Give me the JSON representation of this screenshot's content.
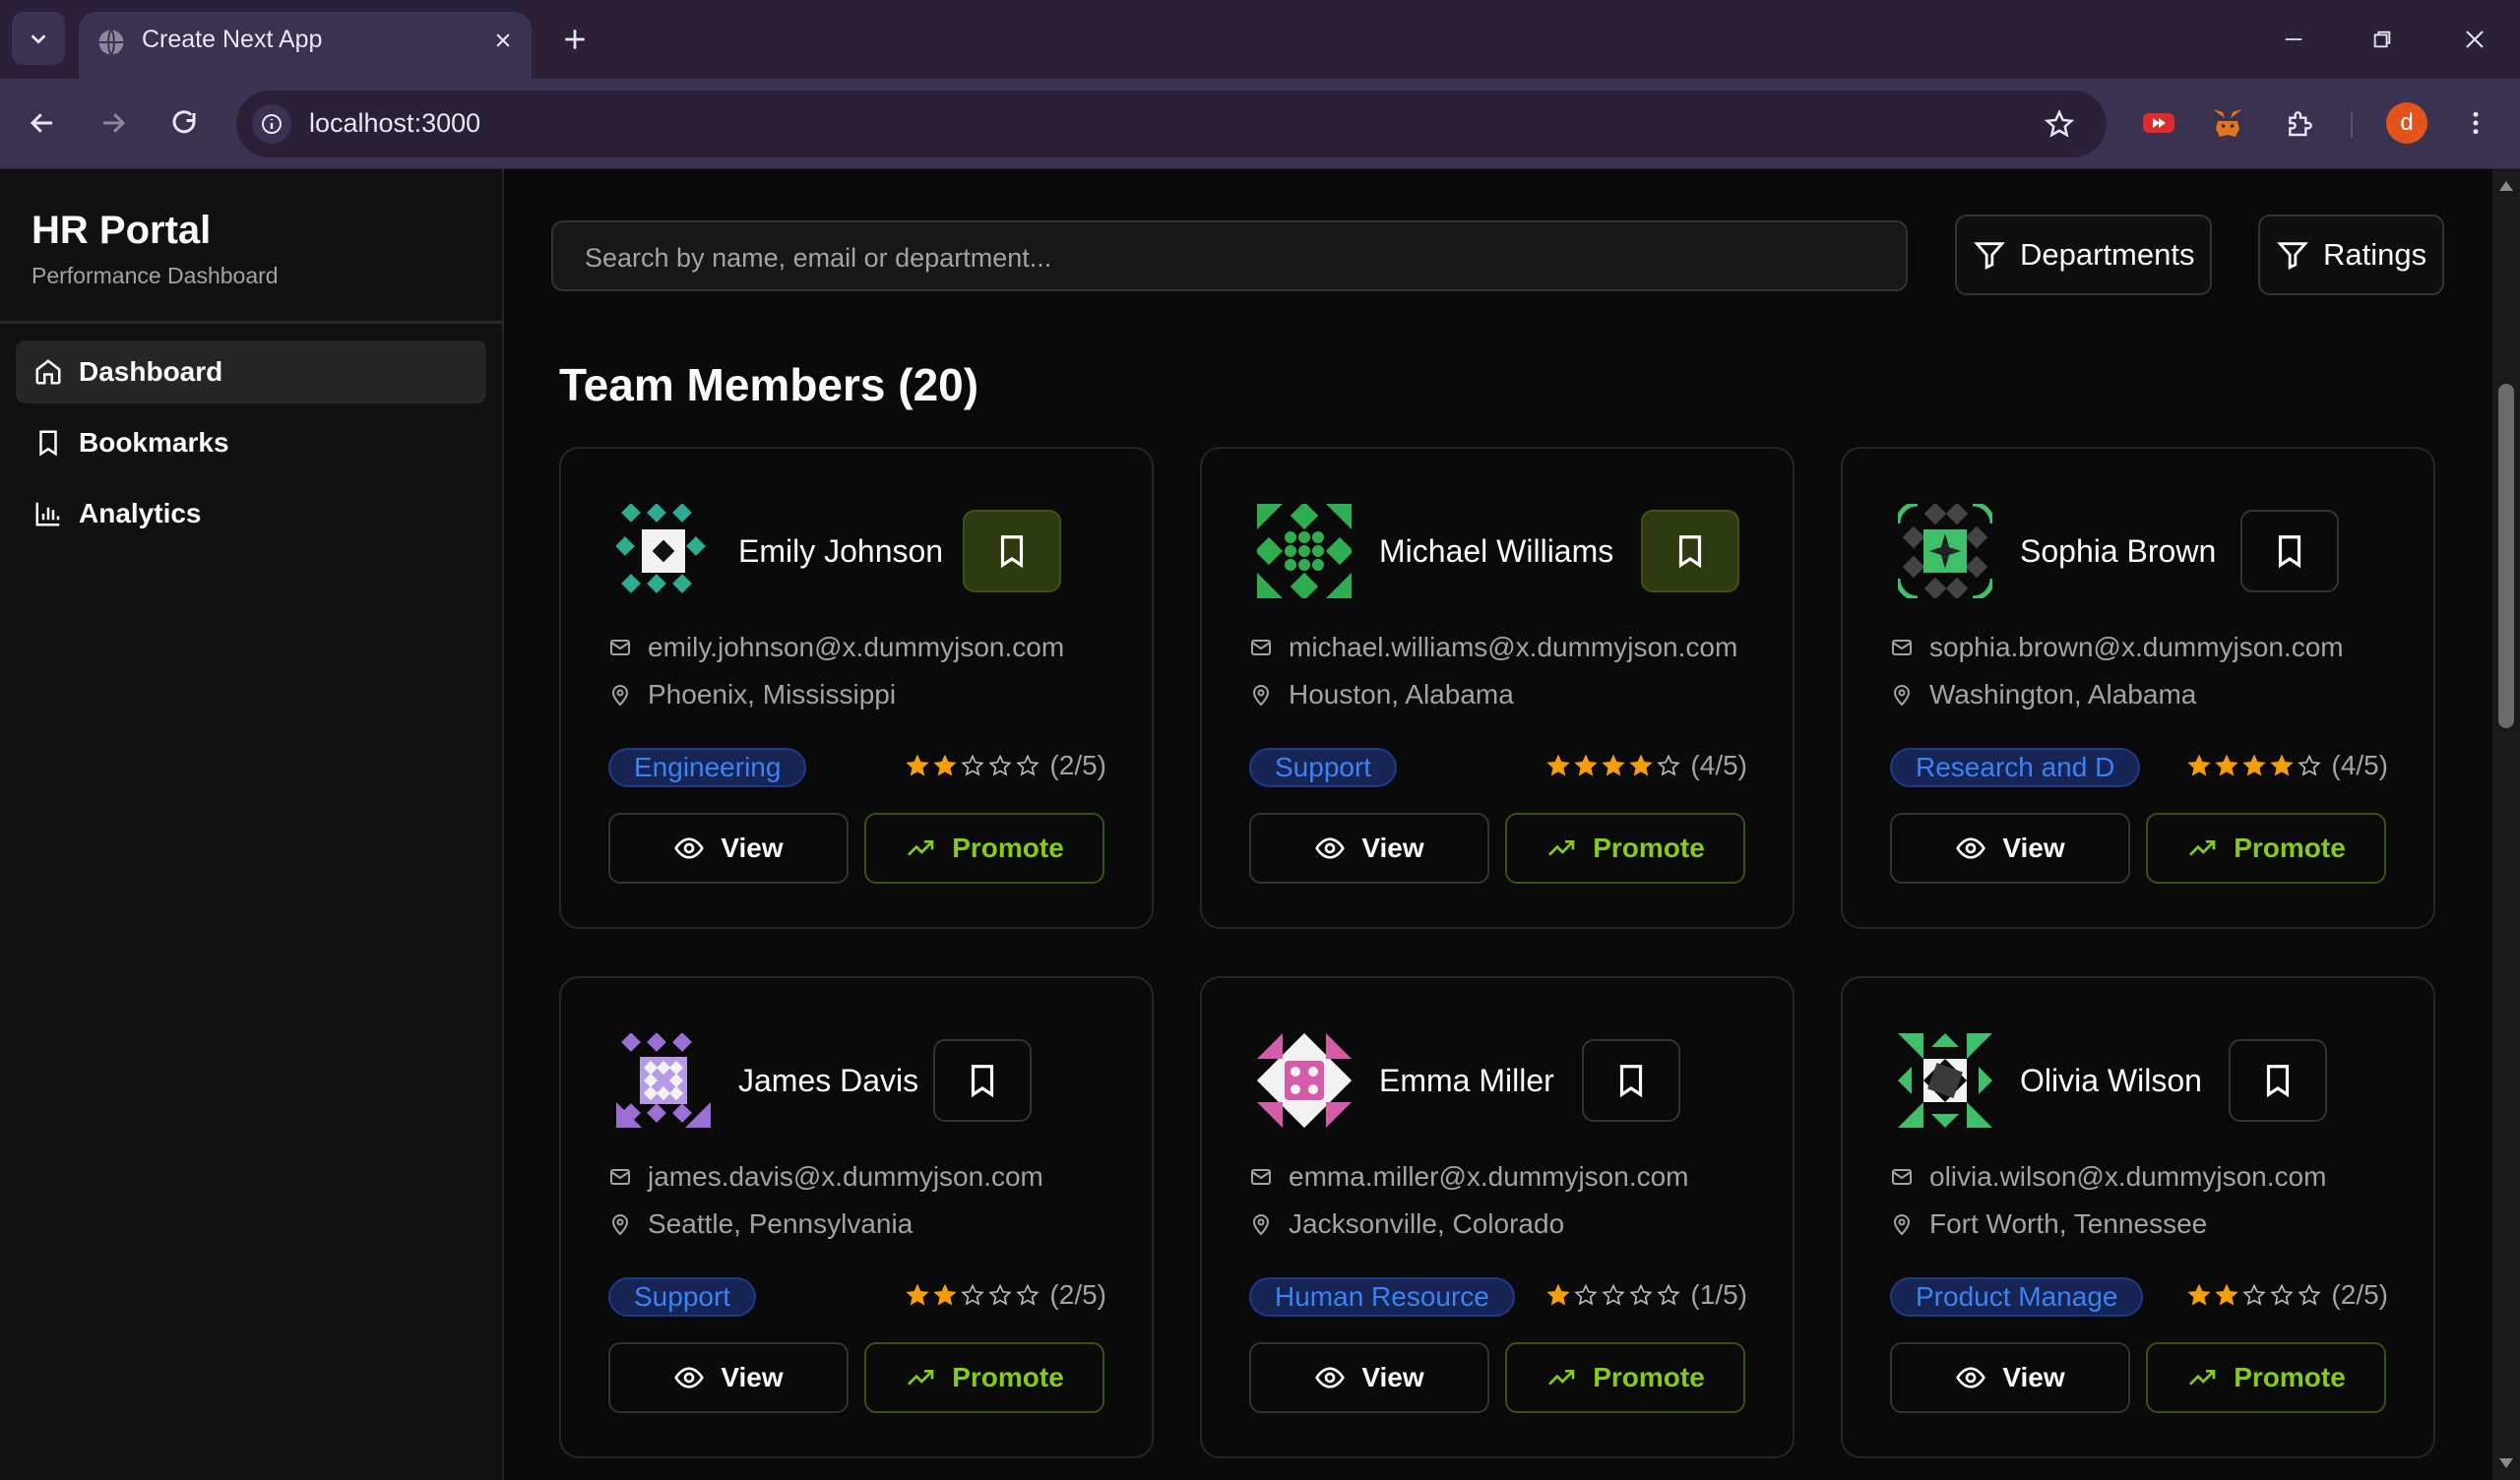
{
  "browser": {
    "tab_title": "Create Next App",
    "url": "localhost:3000",
    "profile_initial": "d"
  },
  "sidebar": {
    "title": "HR Portal",
    "subtitle": "Performance Dashboard",
    "items": [
      {
        "label": "Dashboard",
        "icon": "home-icon",
        "active": true
      },
      {
        "label": "Bookmarks",
        "icon": "bookmark-icon",
        "active": false
      },
      {
        "label": "Analytics",
        "icon": "bar-chart-icon",
        "active": false
      }
    ]
  },
  "search": {
    "placeholder": "Search by name, email or department..."
  },
  "filters": {
    "departments_label": "Departments",
    "ratings_label": "Ratings"
  },
  "section_title": "Team Members (20)",
  "colors": {
    "accent_green": "#84cc16",
    "dept_blue": "#3b82f6",
    "star": "#f59e0b"
  },
  "cards": [
    {
      "name": "Emily Johnson",
      "email": "emily.johnson@x.dummyjson.com",
      "location": "Phoenix, Mississippi",
      "department": "Engineering",
      "rating": 2,
      "rating_text": "(2/5)",
      "bookmarked": true,
      "view_label": "View",
      "promote_label": "Promote"
    },
    {
      "name": "Michael Williams",
      "email": "michael.williams@x.dummyjson.com",
      "location": "Houston, Alabama",
      "department": "Support",
      "rating": 4,
      "rating_text": "(4/5)",
      "bookmarked": true,
      "view_label": "View",
      "promote_label": "Promote"
    },
    {
      "name": "Sophia Brown",
      "email": "sophia.brown@x.dummyjson.com",
      "location": "Washington, Alabama",
      "department": "Research and D",
      "rating": 4,
      "rating_text": "(4/5)",
      "bookmarked": false,
      "view_label": "View",
      "promote_label": "Promote"
    },
    {
      "name": "James Davis",
      "email": "james.davis@x.dummyjson.com",
      "location": "Seattle, Pennsylvania",
      "department": "Support",
      "rating": 2,
      "rating_text": "(2/5)",
      "bookmarked": false,
      "view_label": "View",
      "promote_label": "Promote"
    },
    {
      "name": "Emma Miller",
      "email": "emma.miller@x.dummyjson.com",
      "location": "Jacksonville, Colorado",
      "department": "Human Resource",
      "rating": 1,
      "rating_text": "(1/5)",
      "bookmarked": false,
      "view_label": "View",
      "promote_label": "Promote"
    },
    {
      "name": "Olivia Wilson",
      "email": "olivia.wilson@x.dummyjson.com",
      "location": "Fort Worth, Tennessee",
      "department": "Product Manage",
      "rating": 2,
      "rating_text": "(2/5)",
      "bookmarked": false,
      "view_label": "View",
      "promote_label": "Promote"
    }
  ]
}
